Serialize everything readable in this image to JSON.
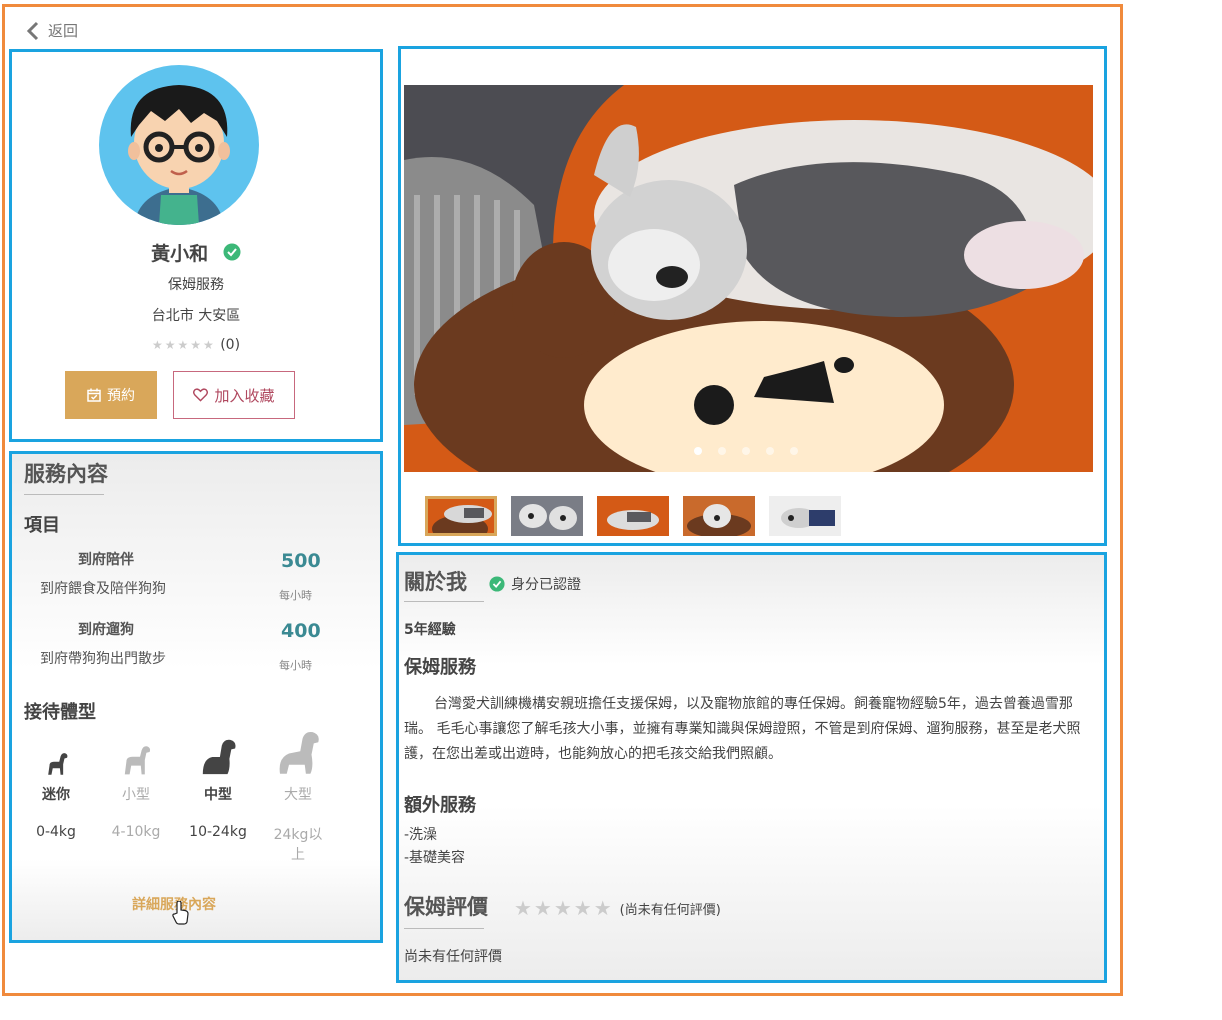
{
  "nav": {
    "back_label": "返回"
  },
  "profile": {
    "name": "黃小和",
    "service_type": "保姆服務",
    "location": "台北市 大安區",
    "rating_count": "(0)",
    "book_label": "預約",
    "favorite_label": "加入收藏"
  },
  "services": {
    "title": "服務內容",
    "items_heading": "項目",
    "items": [
      {
        "name": "到府陪伴",
        "desc": "到府餵食及陪伴狗狗",
        "price": "500",
        "unit": "每小時"
      },
      {
        "name": "到府遛狗",
        "desc": "到府帶狗狗出門散步",
        "price": "400",
        "unit": "每小時"
      }
    ],
    "sizes_heading": "接待體型",
    "sizes": [
      {
        "label": "迷你",
        "range": "0-4kg",
        "accepted": true
      },
      {
        "label": "小型",
        "range": "4-10kg",
        "accepted": false
      },
      {
        "label": "中型",
        "range": "10-24kg",
        "accepted": true
      },
      {
        "label": "大型",
        "range": "24kg以上",
        "accepted": false
      }
    ],
    "detail_link": "詳細服務內容"
  },
  "gallery": {
    "photo_count": 5,
    "active_index": 0
  },
  "about": {
    "title": "關於我",
    "verified_label": "身分已認證",
    "experience": "5年經驗",
    "service_heading": "保姆服務",
    "description": "台灣愛犬訓練機構安親班擔任支援保姆，以及寵物旅館的專任保姆。飼養寵物經驗5年，過去曾養過雪那瑞。 毛毛心事讓您了解毛孩大小事，並擁有專業知識與保姆證照，不管是到府保姆、遛狗服務，甚至是老犬照護，在您出差或出遊時，也能夠放心的把毛孩交給我們照顧。",
    "extra_heading": "額外服務",
    "extras": [
      "-洗澡",
      "-基礎美容"
    ],
    "review_heading": "保姆評價",
    "review_note": "(尚未有任何評價)",
    "no_reviews": "尚未有任何評價"
  },
  "colors": {
    "accent": "#d9a75a",
    "highlight_border": "#1aa3e0",
    "outer_border": "#f08a3c",
    "price": "#3b8a93",
    "verified": "#3cb878"
  }
}
